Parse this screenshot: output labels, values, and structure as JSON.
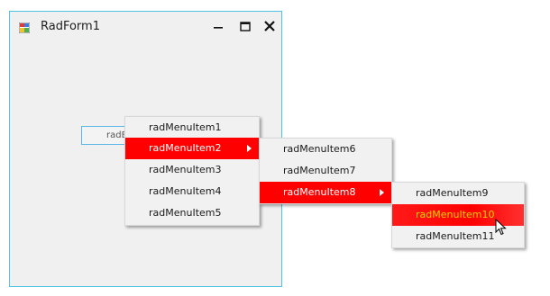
{
  "window": {
    "title": "RadForm1",
    "icons": {
      "app": "app-form-icon",
      "minimize": "minimize-icon",
      "maximize": "maximize-icon",
      "close": "close-icon"
    },
    "border_color": "#4fc3df"
  },
  "button": {
    "label": "radButton1"
  },
  "menus": {
    "level1": {
      "items": [
        "radMenuItem1",
        "radMenuItem2",
        "radMenuItem3",
        "radMenuItem4",
        "radMenuItem5"
      ],
      "active_item": "radMenuItem2"
    },
    "level2": {
      "items": [
        "radMenuItem6",
        "radMenuItem7",
        "radMenuItem8"
      ],
      "active_item": "radMenuItem8"
    },
    "level3": {
      "items": [
        "radMenuItem9",
        "radMenuItem10",
        "radMenuItem11"
      ],
      "hover_item": "radMenuItem10"
    }
  },
  "colors": {
    "highlight": "#ff0000",
    "hover_text": "#e6d200",
    "menu_bg": "#f1f1f1"
  },
  "cursor": "mouse-pointer-icon"
}
